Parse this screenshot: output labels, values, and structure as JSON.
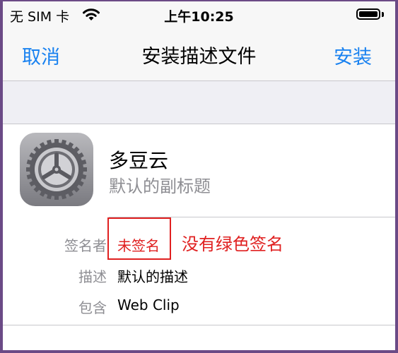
{
  "status_bar": {
    "carrier": "无 SIM 卡",
    "time": "上午10:25",
    "battery_level": 1.0
  },
  "nav": {
    "cancel_label": "取消",
    "title": "安装描述文件",
    "install_label": "安装"
  },
  "profile": {
    "name": "多豆云",
    "subtitle": "默认的副标题",
    "rows": [
      {
        "label": "签名者",
        "value": "未签名"
      },
      {
        "label": "描述",
        "value": "默认的描述"
      },
      {
        "label": "包含",
        "value": "Web Clip"
      }
    ],
    "annotation": "没有绿色签名"
  },
  "colors": {
    "accent": "#1a82f0",
    "warning": "#e02020"
  },
  "icons": {
    "wifi": "wifi-icon",
    "battery": "battery-icon",
    "app": "settings-gear-icon"
  }
}
